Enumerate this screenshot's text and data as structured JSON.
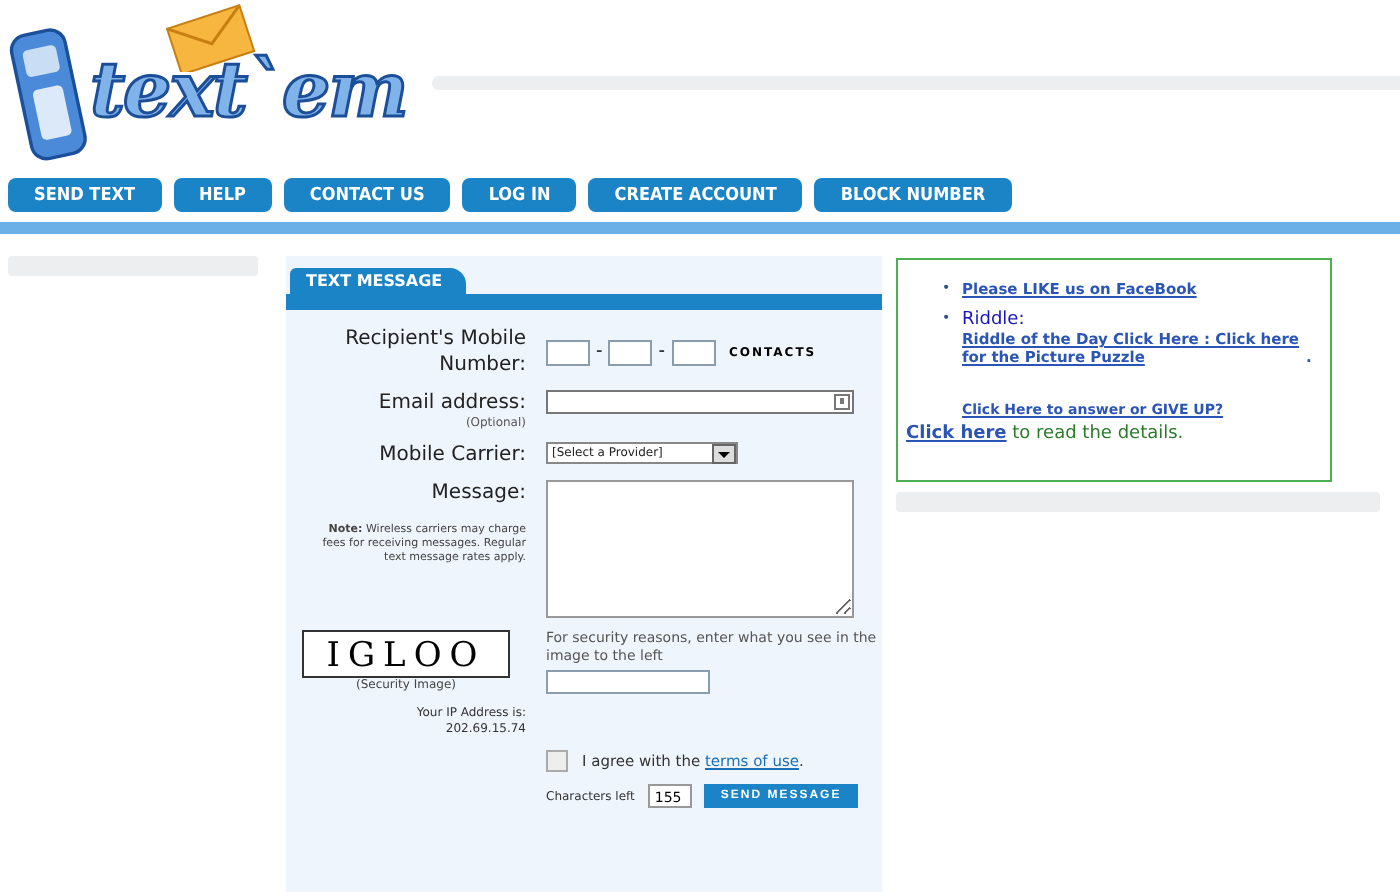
{
  "logo": {
    "text": "text`em"
  },
  "nav": [
    "SEND TEXT",
    "HELP",
    "CONTACT US",
    "LOG IN",
    "CREATE ACCOUNT",
    "BLOCK NUMBER"
  ],
  "form": {
    "tab": "TEXT MESSAGE",
    "recipient_label": "Recipient's Mobile Number:",
    "separator": "-",
    "contacts_link": "CONTACTS",
    "email_label": "Email address:",
    "email_hint": "(Optional)",
    "carrier_label": "Mobile Carrier:",
    "carrier_value": "[Select a Provider]",
    "message_label": "Message:",
    "note_bold": "Note:",
    "note": "Wireless carriers may charge fees for receiving messages. Regular text message rates apply.",
    "captcha_text": "IGLOO",
    "captcha_caption": "(Security Image)",
    "captcha_prompt": "For security reasons, enter what you see in the image to the left",
    "ip_label": "Your IP Address is:",
    "ip": "202.69.15.74",
    "agree_checked": false,
    "agree_text": "I agree with the",
    "terms_link": "terms of use",
    "agree_end": ".",
    "chars_label": "Characters left",
    "chars_value": "155",
    "send_button": "SEND MESSAGE"
  },
  "promo": {
    "bullet": "•",
    "items": [
      {
        "kind": "link",
        "link": "Please LIKE us on FaceBook"
      },
      {
        "kind": "riddle",
        "title": "Riddle:",
        "link": "Riddle of the Day Click Here : Click here for the Picture Puzzle",
        "end": "."
      }
    ],
    "answer_link": "Click Here to answer or GIVE UP?",
    "details_link": "Click here",
    "details_text": "to read the details."
  }
}
